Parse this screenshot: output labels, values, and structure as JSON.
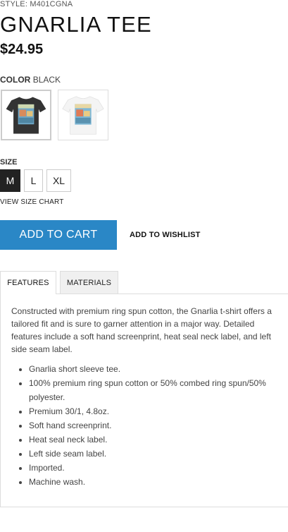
{
  "product": {
    "style_line": "STYLE: M401CGNA",
    "title": "GNARLIA TEE",
    "price": "$24.95"
  },
  "color": {
    "label": "COLOR",
    "selected": "BLACK",
    "swatches": [
      {
        "name": "black",
        "shirt_color": "#333333",
        "selected": true
      },
      {
        "name": "white",
        "shirt_color": "#f4f4f4",
        "selected": false
      }
    ]
  },
  "size": {
    "label": "SIZE",
    "options": [
      "M",
      "L",
      "XL"
    ],
    "selected": "M",
    "chart_link": "VIEW SIZE CHART"
  },
  "actions": {
    "add_to_cart": "ADD TO CART",
    "add_to_wishlist": "ADD TO WISHLIST",
    "accent_color": "#2a87c6"
  },
  "tabs": [
    {
      "label": "FEATURES",
      "active": true
    },
    {
      "label": "MATERIALS",
      "active": false
    }
  ],
  "features": {
    "description": "Constructed with premium ring spun cotton, the Gnarlia t-shirt offers a tailored fit and is sure to garner attention in a major way. Detailed features include a soft hand screenprint, heat seal neck label, and left side seam label.",
    "bullets": [
      "Gnarlia short sleeve tee.",
      "100% premium ring spun cotton or 50% combed ring spun/50% polyester.",
      "Premium 30/1, 4.8oz.",
      "Soft hand screenprint.",
      "Heat seal neck label.",
      "Left side seam label.",
      "Imported.",
      "Machine wash."
    ]
  }
}
